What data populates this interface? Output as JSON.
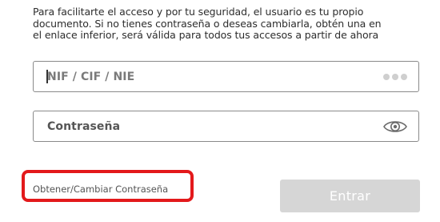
{
  "intro": {
    "line1": "Para facilitarte el acceso y por tu seguridad, el usuario es tu propio",
    "line2": "documento. Si no tienes contraseña o deseas cambiarla, obtén una en",
    "line3": "el enlace inferior, será válida para todos tus accesos a partir de ahora"
  },
  "form": {
    "user_field": {
      "placeholder": "NIF / CIF / NIE",
      "icon": "dots-icon"
    },
    "password_field": {
      "placeholder": "Contraseña",
      "icon": "eye-icon"
    }
  },
  "links": {
    "change_password": "Obtener/Cambiar Contraseña"
  },
  "buttons": {
    "enter": "Entrar"
  },
  "colors": {
    "highlight": "#e3191b",
    "button_disabled": "#d6d6d6",
    "border": "#8a8a8a"
  }
}
